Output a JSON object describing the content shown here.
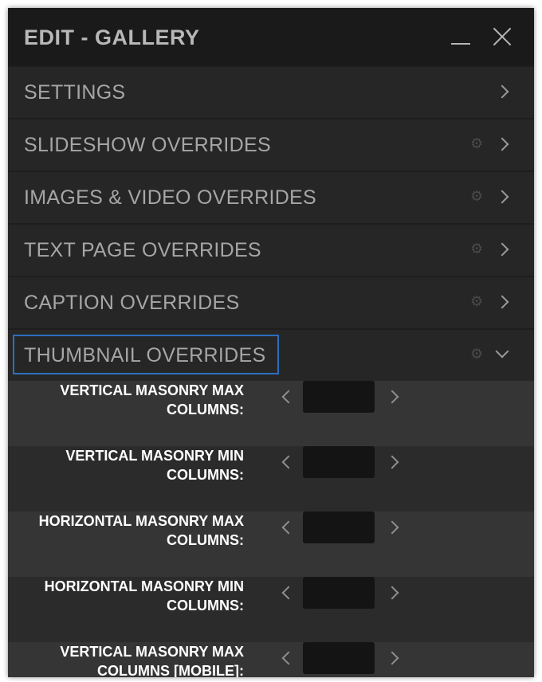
{
  "window": {
    "title": "EDIT - GALLERY"
  },
  "sections": [
    {
      "label": "SETTINGS",
      "has_gear": false,
      "expanded": false
    },
    {
      "label": "SLIDESHOW OVERRIDES",
      "has_gear": true,
      "expanded": false
    },
    {
      "label": "IMAGES & VIDEO OVERRIDES",
      "has_gear": true,
      "expanded": false
    },
    {
      "label": "TEXT PAGE OVERRIDES",
      "has_gear": true,
      "expanded": false
    },
    {
      "label": "CAPTION OVERRIDES",
      "has_gear": true,
      "expanded": false
    },
    {
      "label": "THUMBNAIL OVERRIDES",
      "has_gear": true,
      "expanded": true,
      "focused": true
    }
  ],
  "thumbnail_fields": [
    {
      "line1": "VERTICAL MASONRY MAX",
      "line2": "COLUMNS:",
      "value": ""
    },
    {
      "line1": "VERTICAL MASONRY MIN",
      "line2": "COLUMNS:",
      "value": ""
    },
    {
      "line1": "HORIZONTAL MASONRY MAX",
      "line2": "COLUMNS:",
      "value": ""
    },
    {
      "line1": "HORIZONTAL MASONRY MIN",
      "line2": "COLUMNS:",
      "value": ""
    },
    {
      "line1": "VERTICAL MASONRY MAX",
      "line2": "COLUMNS [MOBILE]:",
      "value": ""
    }
  ],
  "icons": {
    "minimize": "minimize-icon",
    "close": "close-icon",
    "section_chevron": "chevron-right-icon",
    "expanded_chevron": "chevron-down-icon",
    "gear": "gear-icon",
    "decrement": "chevron-left-icon",
    "increment": "chevron-right-icon"
  },
  "colors": {
    "focus_ring": "#2b6fbf",
    "panel_bg": "#2b2b2b",
    "titlebar_bg": "#1a1a1a",
    "input_bg": "#141414"
  }
}
